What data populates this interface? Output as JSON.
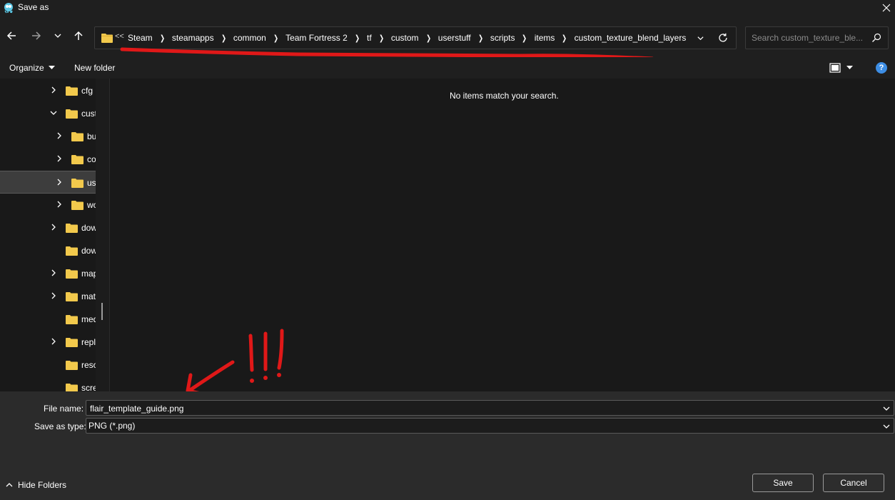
{
  "window": {
    "title": "Save as",
    "app_icon": "save-as-app-icon",
    "close_icon": "close-icon"
  },
  "nav": {
    "back_icon": "arrow-left-icon",
    "forward_icon": "arrow-right-icon",
    "recent_icon": "chevron-down-icon",
    "up_icon": "arrow-up-icon"
  },
  "address": {
    "overflow": "<<",
    "crumbs": [
      "Steam",
      "steamapps",
      "common",
      "Team Fortress 2",
      "tf",
      "custom",
      "userstuff",
      "scripts",
      "items",
      "custom_texture_blend_layers"
    ]
  },
  "search": {
    "placeholder": "Search custom_texture_ble..."
  },
  "toolbar": {
    "organize": "Organize",
    "new_folder": "New folder",
    "help": "?"
  },
  "navpane": {
    "items": [
      {
        "label": "cfg",
        "expander": "chevron-right"
      },
      {
        "label": "custom",
        "expander": "chevron-down"
      },
      {
        "label": "buildings",
        "expander": "chevron-right"
      },
      {
        "label": "cosmetics",
        "expander": "chevron-right"
      },
      {
        "label": "userstuff",
        "expander": "chevron-right",
        "selected": true
      },
      {
        "label": "workshop",
        "expander": "chevron-right"
      },
      {
        "label": "download",
        "expander": "chevron-right"
      },
      {
        "label": "downloadlists",
        "expander": "none"
      },
      {
        "label": "maps",
        "expander": "chevron-right"
      },
      {
        "label": "materials",
        "expander": "chevron-right"
      },
      {
        "label": "media",
        "expander": "none"
      },
      {
        "label": "replay",
        "expander": "chevron-right"
      },
      {
        "label": "resource",
        "expander": "none"
      },
      {
        "label": "screenshots",
        "expander": "none"
      }
    ]
  },
  "content": {
    "empty_message": "No items match your search."
  },
  "footer": {
    "filename_label": "File name:",
    "filename_value": "flair_template_guide.png",
    "savetype_label": "Save as type:",
    "savetype_value": "PNG (*.png)",
    "hide_folders": "Hide Folders",
    "save": "Save",
    "cancel": "Cancel"
  },
  "colors": {
    "accent": "#3d8ee5",
    "folder": "#f2c94c",
    "annotation": "#e01818"
  }
}
